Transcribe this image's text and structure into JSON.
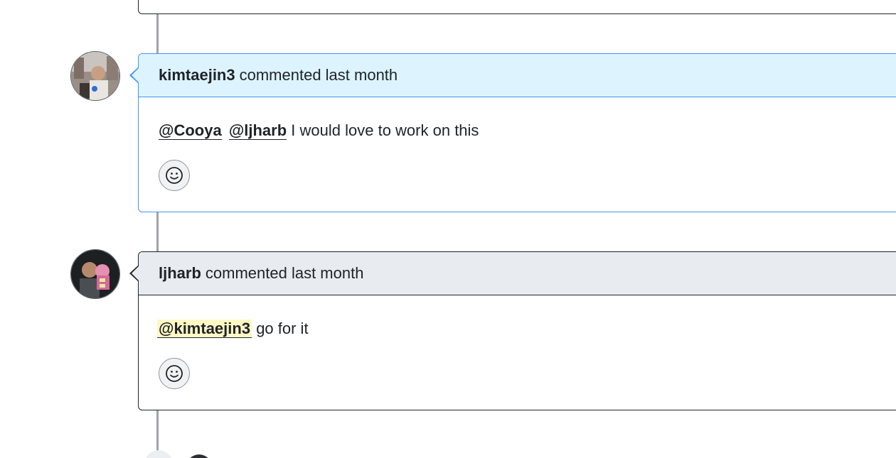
{
  "comments": [
    {
      "author": "kimtaejin3",
      "meta": "commented last month",
      "mentions": [
        "@Cooya",
        "@ljharb"
      ],
      "text": "I would love to work on this",
      "avatar_icon": "user-avatar-photo",
      "reaction_icon": "smiley-icon"
    },
    {
      "author": "ljharb",
      "meta": "commented last month",
      "mentions": [
        "@kimtaejin3"
      ],
      "text": "go for it",
      "avatar_icon": "user-avatar-photo",
      "reaction_icon": "smiley-icon"
    }
  ],
  "colors": {
    "highlight_border": "#4493f8",
    "highlight_header": "#ddf4ff",
    "default_header": "#e8ebef",
    "self_mention_bg": "#fff8c5"
  }
}
